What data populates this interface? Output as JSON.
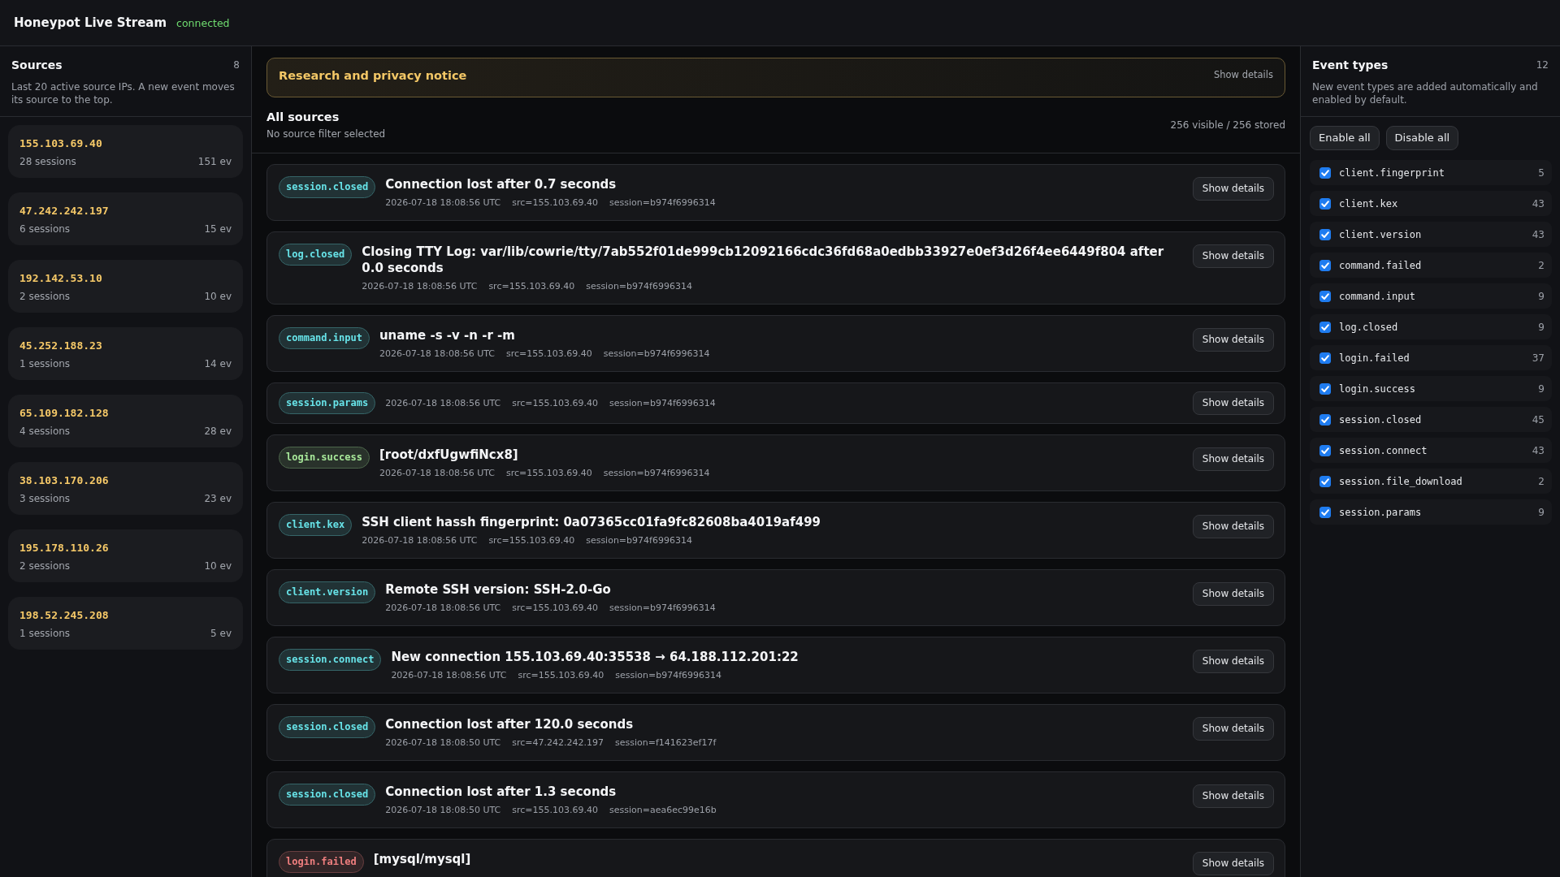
{
  "header": {
    "title": "Honeypot Live Stream",
    "status": "connected",
    "connected": true
  },
  "sources_panel": {
    "title": "Sources",
    "count": "8",
    "description": "Last 20 active source IPs. A new event moves its source to the top.",
    "items": [
      {
        "ip": "155.103.69.40",
        "sessions": "28 sessions",
        "events": "151 ev",
        "selected": false
      },
      {
        "ip": "47.242.242.197",
        "sessions": "6 sessions",
        "events": "15 ev",
        "selected": false
      },
      {
        "ip": "192.142.53.10",
        "sessions": "2 sessions",
        "events": "10 ev",
        "selected": false
      },
      {
        "ip": "45.252.188.23",
        "sessions": "1 sessions",
        "events": "14 ev",
        "selected": false
      },
      {
        "ip": "65.109.182.128",
        "sessions": "4 sessions",
        "events": "28 ev",
        "selected": false
      },
      {
        "ip": "38.103.170.206",
        "sessions": "3 sessions",
        "events": "23 ev",
        "selected": false
      },
      {
        "ip": "195.178.110.26",
        "sessions": "2 sessions",
        "events": "10 ev",
        "selected": false
      },
      {
        "ip": "198.52.245.208",
        "sessions": "1 sessions",
        "events": "5 ev",
        "selected": false
      }
    ]
  },
  "notice": {
    "title": "Research and privacy notice",
    "action": "Show details"
  },
  "feed": {
    "title": "All sources",
    "subtitle": "No source filter selected",
    "counts": "256 visible / 256 stored",
    "events": [
      {
        "type": "session.closed",
        "color": "#67e3e8",
        "title": "Connection lost after 0.7 seconds",
        "time": "2026-07-18 18:08:56 UTC",
        "src": "src=155.103.69.40",
        "session": "session=b974f6996314",
        "action": "Show details"
      },
      {
        "type": "log.closed",
        "color": "#67e3e8",
        "title": "Closing TTY Log: var/lib/cowrie/tty/7ab552f01de999cb12092166cdc36fd68a0edbb33927e0ef3d26f4ee6449f804 after 0.0 seconds",
        "time": "2026-07-18 18:08:56 UTC",
        "src": "src=155.103.69.40",
        "session": "session=b974f6996314",
        "action": "Show details"
      },
      {
        "type": "command.input",
        "color": "#67e3e8",
        "title": "uname -s -v -n -r -m",
        "time": "2026-07-18 18:08:56 UTC",
        "src": "src=155.103.69.40",
        "session": "session=b974f6996314",
        "action": "Show details"
      },
      {
        "type": "session.params",
        "color": "#67e3e8",
        "time": "2026-07-18 18:08:56 UTC",
        "src": "src=155.103.69.40",
        "session": "session=b974f6996314",
        "action": "Show details"
      },
      {
        "type": "login.success",
        "color": "#a8e89a",
        "title": "[root/dxfUgwfiNcx8]",
        "time": "2026-07-18 18:08:56 UTC",
        "src": "src=155.103.69.40",
        "session": "session=b974f6996314",
        "action": "Show details"
      },
      {
        "type": "client.kex",
        "color": "#67e3e8",
        "title": "SSH client hassh fingerprint: 0a07365cc01fa9fc82608ba4019af499",
        "time": "2026-07-18 18:08:56 UTC",
        "src": "src=155.103.69.40",
        "session": "session=b974f6996314",
        "action": "Show details"
      },
      {
        "type": "client.version",
        "color": "#67e3e8",
        "title": "Remote SSH version: SSH-2.0-Go",
        "time": "2026-07-18 18:08:56 UTC",
        "src": "src=155.103.69.40",
        "session": "session=b974f6996314",
        "action": "Show details"
      },
      {
        "type": "session.connect",
        "color": "#67e3e8",
        "title": "New connection 155.103.69.40:35538 → 64.188.112.201:22",
        "time": "2026-07-18 18:08:56 UTC",
        "src": "src=155.103.69.40",
        "session": "session=b974f6996314",
        "action": "Show details"
      },
      {
        "type": "session.closed",
        "color": "#67e3e8",
        "title": "Connection lost after 120.0 seconds",
        "time": "2026-07-18 18:08:50 UTC",
        "src": "src=47.242.242.197",
        "session": "session=f141623ef17f",
        "action": "Show details"
      },
      {
        "type": "session.closed",
        "color": "#67e3e8",
        "title": "Connection lost after 1.3 seconds",
        "time": "2026-07-18 18:08:50 UTC",
        "src": "src=155.103.69.40",
        "session": "session=aea6ec99e16b",
        "action": "Show details"
      },
      {
        "type": "login.failed",
        "color": "#f07f7f",
        "title": "[mysql/mysql]",
        "action": "Show details"
      }
    ]
  },
  "event_types_panel": {
    "title": "Event types",
    "count": "12",
    "description": "New event types are added automatically and enabled by default.",
    "buttons": [
      "Enable all",
      "Disable all"
    ],
    "items": [
      {
        "name": "client.fingerprint",
        "count": "5",
        "checked": true
      },
      {
        "name": "client.kex",
        "count": "43",
        "checked": true
      },
      {
        "name": "client.version",
        "count": "43",
        "checked": true
      },
      {
        "name": "command.failed",
        "count": "2",
        "checked": true
      },
      {
        "name": "command.input",
        "count": "9",
        "checked": true
      },
      {
        "name": "log.closed",
        "count": "9",
        "checked": true
      },
      {
        "name": "login.failed",
        "count": "37",
        "checked": true
      },
      {
        "name": "login.success",
        "count": "9",
        "checked": true
      },
      {
        "name": "session.closed",
        "count": "45",
        "checked": true
      },
      {
        "name": "session.connect",
        "count": "43",
        "checked": true
      },
      {
        "name": "session.file_download",
        "count": "2",
        "checked": true
      },
      {
        "name": "session.params",
        "count": "9",
        "checked": true
      }
    ]
  }
}
